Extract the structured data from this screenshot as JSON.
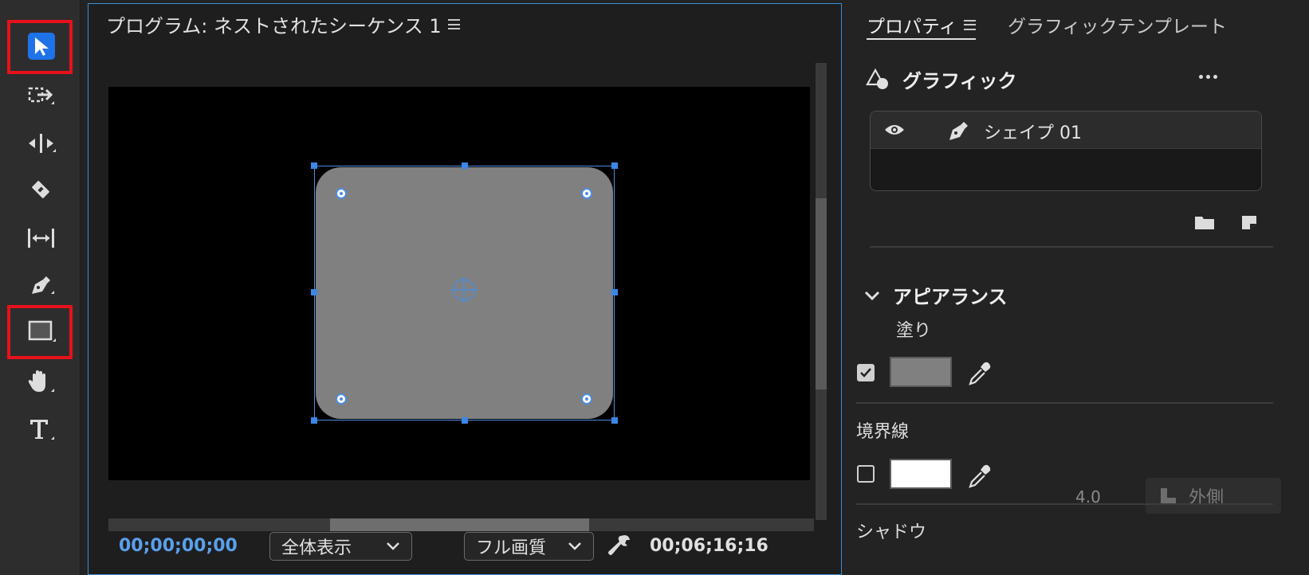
{
  "toolbar": {
    "tools": [
      {
        "name": "selection-tool",
        "icon": "arrow-pointer-icon",
        "active": true
      },
      {
        "name": "track-select-tool",
        "icon": "track-select-icon"
      },
      {
        "name": "ripple-edit-tool",
        "icon": "ripple-edit-icon"
      },
      {
        "name": "razor-tool",
        "icon": "razor-icon"
      },
      {
        "name": "slip-tool",
        "icon": "slip-icon"
      },
      {
        "name": "pen-tool",
        "icon": "pen-icon"
      },
      {
        "name": "rectangle-tool",
        "icon": "rectangle-icon"
      },
      {
        "name": "hand-tool",
        "icon": "hand-icon"
      },
      {
        "name": "type-tool",
        "icon": "type-icon"
      }
    ],
    "highlighted": [
      "selection-tool",
      "rectangle-tool"
    ],
    "highlight_color": "#e8111b",
    "active_color": "#1e73e8"
  },
  "program": {
    "title": "プログラム: ネストされたシーケンス 1",
    "timecode": "00;00;00;00",
    "zoom": "全体表示",
    "quality": "フル画質",
    "duration": "00;06;16;16",
    "shape_fill": "#808080",
    "selection_color": "#3b86e6"
  },
  "properties": {
    "tab_properties": "プロパティ",
    "tab_graphic_templates": "グラフィックテンプレート",
    "graphic_section": "グラフィック",
    "layer_name": "シェイプ 01",
    "appearance_section": "アピアランス",
    "fill_label": "塗り",
    "fill_checked": true,
    "fill_color": "#808080",
    "stroke_label": "境界線",
    "stroke_checked": false,
    "stroke_color": "#ffffff",
    "stroke_width": "4.0",
    "stroke_align": "外側",
    "shadow_label": "シャドウ"
  }
}
